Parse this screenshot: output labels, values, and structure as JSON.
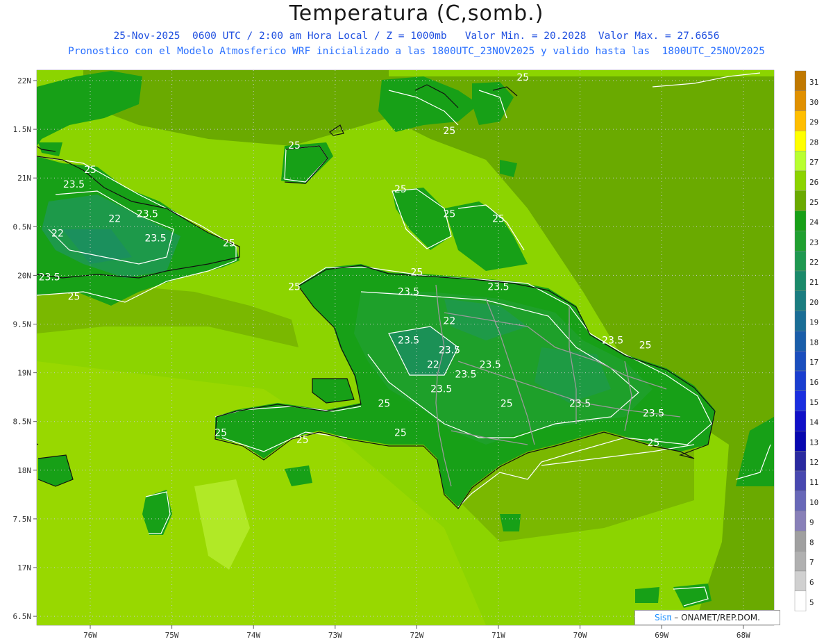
{
  "header": {
    "title": "Temperatura (C,somb.)",
    "line1": "25-Nov-2025  0600 UTC / 2:00 am Hora Local / Z = 1000mb   Valor Min. = 20.2028  Valor Max. = 27.6656",
    "line2": "Pronostico con el Modelo Atmosferico WRF inicializado a las 1800UTC_23NOV2025 y valido hasta las  1800UTC_25NOV2025"
  },
  "axes": {
    "lon_ticks": [
      "76W",
      "75W",
      "74W",
      "73W",
      "72W",
      "71W",
      "70W",
      "69W",
      "68W"
    ],
    "lat_ticks": [
      "22N",
      "1.5N",
      "21N",
      "0.5N",
      "20N",
      "9.5N",
      "19N",
      "8.5N",
      "18N",
      "7.5N",
      "17N",
      "6.5N"
    ]
  },
  "colorbar": {
    "levels": [
      "31",
      "30",
      "29",
      "28",
      "27",
      "26",
      "25",
      "24",
      "23",
      "22",
      "21",
      "20",
      "19",
      "18",
      "17",
      "16",
      "15",
      "14",
      "13",
      "12",
      "11",
      "10",
      "9",
      "8",
      "7",
      "6",
      "5"
    ],
    "colors": [
      "#c07800",
      "#e09000",
      "#ffbe00",
      "#ffff00",
      "#b8ff30",
      "#8cd400",
      "#6aaa00",
      "#17a017",
      "#20a030",
      "#1e9850",
      "#1a8a6a",
      "#1a7d80",
      "#1a6e96",
      "#1a5eaa",
      "#1a4ebe",
      "#1a3ed0",
      "#1a2ee0",
      "#1010c8",
      "#0808b0",
      "#2a2aa0",
      "#4848b0",
      "#6868b8",
      "#8880b8",
      "#a0a0a0",
      "#b0b0b0",
      "#d0d0d0",
      "#ffffff"
    ]
  },
  "contour_labels": [
    {
      "text": "25",
      "lon": -70.7,
      "lat": 22.0
    },
    {
      "text": "25",
      "lon": -73.5,
      "lat": 21.3
    },
    {
      "text": "25",
      "lon": -71.6,
      "lat": 21.45
    },
    {
      "text": "25",
      "lon": -76.0,
      "lat": 21.05
    },
    {
      "text": "23.5",
      "lon": -76.2,
      "lat": 20.9
    },
    {
      "text": "22",
      "lon": -75.7,
      "lat": 20.55
    },
    {
      "text": "23.5",
      "lon": -75.3,
      "lat": 20.6
    },
    {
      "text": "22",
      "lon": -76.4,
      "lat": 20.4
    },
    {
      "text": "23.5",
      "lon": -75.2,
      "lat": 20.35
    },
    {
      "text": "25",
      "lon": -74.3,
      "lat": 20.3
    },
    {
      "text": "23.5",
      "lon": -76.5,
      "lat": 19.95
    },
    {
      "text": "25",
      "lon": -76.2,
      "lat": 19.75
    },
    {
      "text": "25",
      "lon": -72.2,
      "lat": 20.85
    },
    {
      "text": "25",
      "lon": -71.6,
      "lat": 20.6
    },
    {
      "text": "25",
      "lon": -71.0,
      "lat": 20.55
    },
    {
      "text": "25",
      "lon": -72.0,
      "lat": 20.0
    },
    {
      "text": "25",
      "lon": -73.5,
      "lat": 19.85
    },
    {
      "text": "23.5",
      "lon": -72.1,
      "lat": 19.8
    },
    {
      "text": "23.5",
      "lon": -71.0,
      "lat": 19.85
    },
    {
      "text": "22",
      "lon": -71.6,
      "lat": 19.5
    },
    {
      "text": "23.5",
      "lon": -72.1,
      "lat": 19.3
    },
    {
      "text": "23.5",
      "lon": -71.6,
      "lat": 19.2
    },
    {
      "text": "22",
      "lon": -71.8,
      "lat": 19.05
    },
    {
      "text": "23.5",
      "lon": -71.4,
      "lat": 18.95
    },
    {
      "text": "23.5",
      "lon": -71.7,
      "lat": 18.8
    },
    {
      "text": "23.5",
      "lon": -71.1,
      "lat": 19.05
    },
    {
      "text": "25",
      "lon": -72.4,
      "lat": 18.65
    },
    {
      "text": "23.5",
      "lon": -70.0,
      "lat": 18.65
    },
    {
      "text": "25",
      "lon": -70.9,
      "lat": 18.65
    },
    {
      "text": "23.5",
      "lon": -69.6,
      "lat": 19.3
    },
    {
      "text": "25",
      "lon": -69.2,
      "lat": 19.25
    },
    {
      "text": "23.5",
      "lon": -69.1,
      "lat": 18.55
    },
    {
      "text": "25",
      "lon": -69.1,
      "lat": 18.25
    },
    {
      "text": "25",
      "lon": -74.4,
      "lat": 18.35
    },
    {
      "text": "25",
      "lon": -73.4,
      "lat": 18.28
    },
    {
      "text": "25",
      "lon": -72.2,
      "lat": 18.35
    }
  ],
  "credit": {
    "brand": "Sisπ",
    "text": "– ONAMET/REP.DOM."
  }
}
